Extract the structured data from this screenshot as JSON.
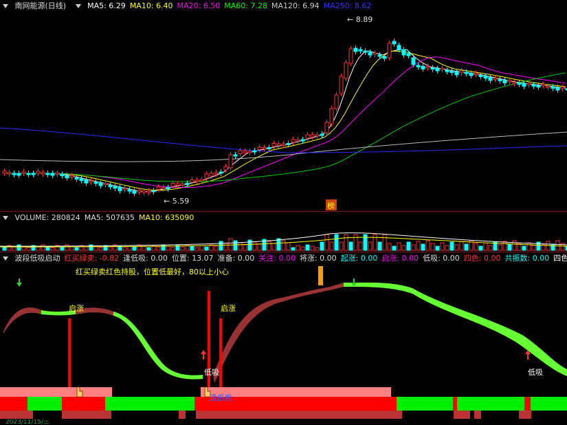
{
  "main_panel": {
    "stock_title": "南网能源(日线)",
    "ma_labels": [
      {
        "text": "MA5: 6.29",
        "color": "#ffffff"
      },
      {
        "text": "MA10: 6.40",
        "color": "#ffff00"
      },
      {
        "text": "MA20: 6.50",
        "color": "#ff00ff"
      },
      {
        "text": "MA60: 7.28",
        "color": "#00ff00"
      },
      {
        "text": "MA120: 6.94",
        "color": "#cccccc"
      },
      {
        "text": "MA250: 8.62",
        "color": "#3333ff"
      }
    ],
    "high_label": "8.89",
    "low_label": "5.59",
    "badge_label": "榜"
  },
  "volume_panel": {
    "labels": [
      {
        "text": "VOLUME: 280824",
        "color": "#dddddd"
      },
      {
        "text": "MA5: 507635",
        "color": "#dddddd"
      },
      {
        "text": "MA10: 635090",
        "color": "#ffff00"
      }
    ]
  },
  "indicator_panel": {
    "labels": [
      {
        "text": "波段低吸启动",
        "color": "#dddddd"
      },
      {
        "text": "红买绿卖: -0.82",
        "color": "#ff3333"
      },
      {
        "text": "逢低吸: 0.00",
        "color": "#dddddd"
      },
      {
        "text": "位置: 13.07",
        "color": "#dddddd"
      },
      {
        "text": "准备: 0.00",
        "color": "#dddddd"
      },
      {
        "text": "关注: 0.00",
        "color": "#ff00ff"
      },
      {
        "text": "将涨: 0.00",
        "color": "#dddddd"
      },
      {
        "text": "起涨: 0.00",
        "color": "#00ffff"
      },
      {
        "text": "启涨: 0.00",
        "color": "#ff00ff"
      },
      {
        "text": "低吸: 0.00",
        "color": "#dddddd"
      },
      {
        "text": "四色: 0.00",
        "color": "#ff3333"
      },
      {
        "text": "共振数: 0.00",
        "color": "#00ffff"
      },
      {
        "text": "四色",
        "color": "#ffffff"
      }
    ],
    "hint": "红买绿卖红色持股，位置低最好，80以上小心",
    "annotations": {
      "qizhang_1": "启涨",
      "qizhang_2": "启涨",
      "dixi_1": "低吸",
      "dixi_2": "低吸",
      "fengdixi": "逢低吸"
    }
  },
  "bottom_axis_label": "2023/11/15/三"
}
